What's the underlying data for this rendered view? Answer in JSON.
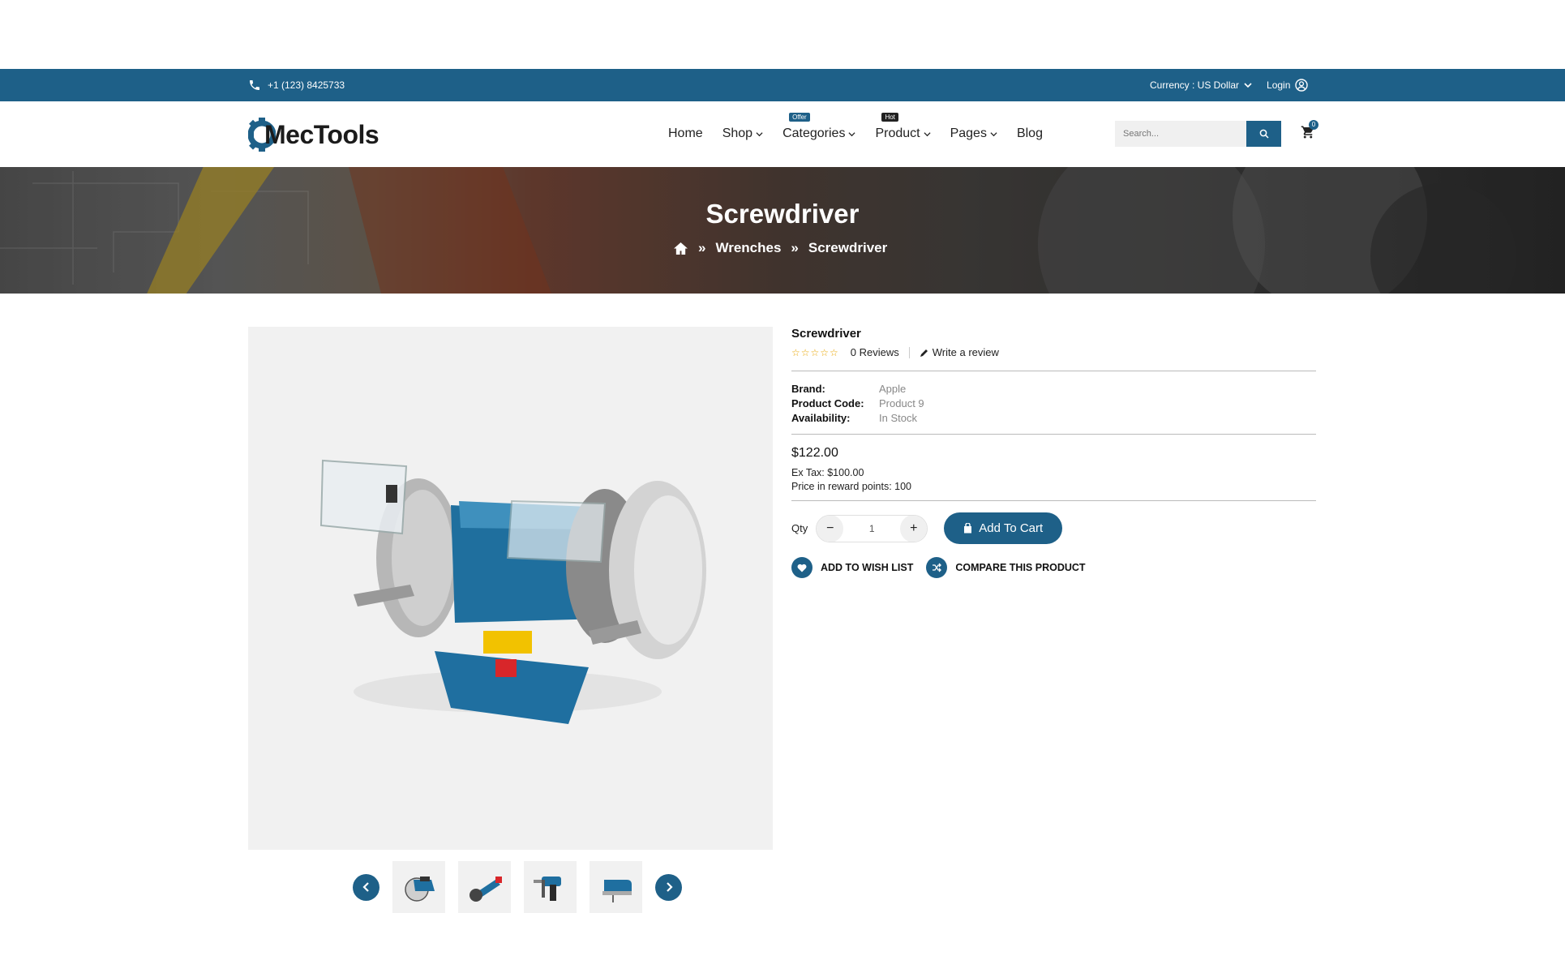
{
  "topbar": {
    "phone": "+1 (123) 8425733",
    "currency": "Currency : US Dollar",
    "login": "Login"
  },
  "brand": {
    "logo_text": "MecTools",
    "accent": "#1e6088"
  },
  "nav": {
    "items": [
      {
        "label": "Home",
        "tag": ""
      },
      {
        "label": "Shop",
        "tag": ""
      },
      {
        "label": "Categories",
        "tag": "Offer"
      },
      {
        "label": "Product",
        "tag": "Hot"
      },
      {
        "label": "Pages",
        "tag": ""
      },
      {
        "label": "Blog",
        "tag": ""
      }
    ]
  },
  "search": {
    "placeholder": "Search..."
  },
  "cart": {
    "count": "0"
  },
  "banner": {
    "title": "Screwdriver",
    "breadcrumb": [
      "Wrenches",
      "Screwdriver"
    ]
  },
  "product": {
    "name": "Screwdriver",
    "rating": 0,
    "reviews": "0 Reviews",
    "write_review": "Write a review",
    "brand_label": "Brand:",
    "brand": "Apple",
    "code_label": "Product Code:",
    "code": "Product 9",
    "availability_label": "Availability:",
    "availability": "In Stock",
    "price": "$122.00",
    "ex_tax": "Ex Tax: $100.00",
    "reward": "Price in reward points: 100",
    "qty_label": "Qty",
    "qty_value": "1",
    "add_to_cart": "Add To Cart",
    "wishlist": "ADD TO WISH LIST",
    "compare": "COMPARE THIS PRODUCT"
  },
  "thumbnails": [
    "circular-saw",
    "angle-grinder",
    "hammer-drill",
    "jigsaw"
  ]
}
